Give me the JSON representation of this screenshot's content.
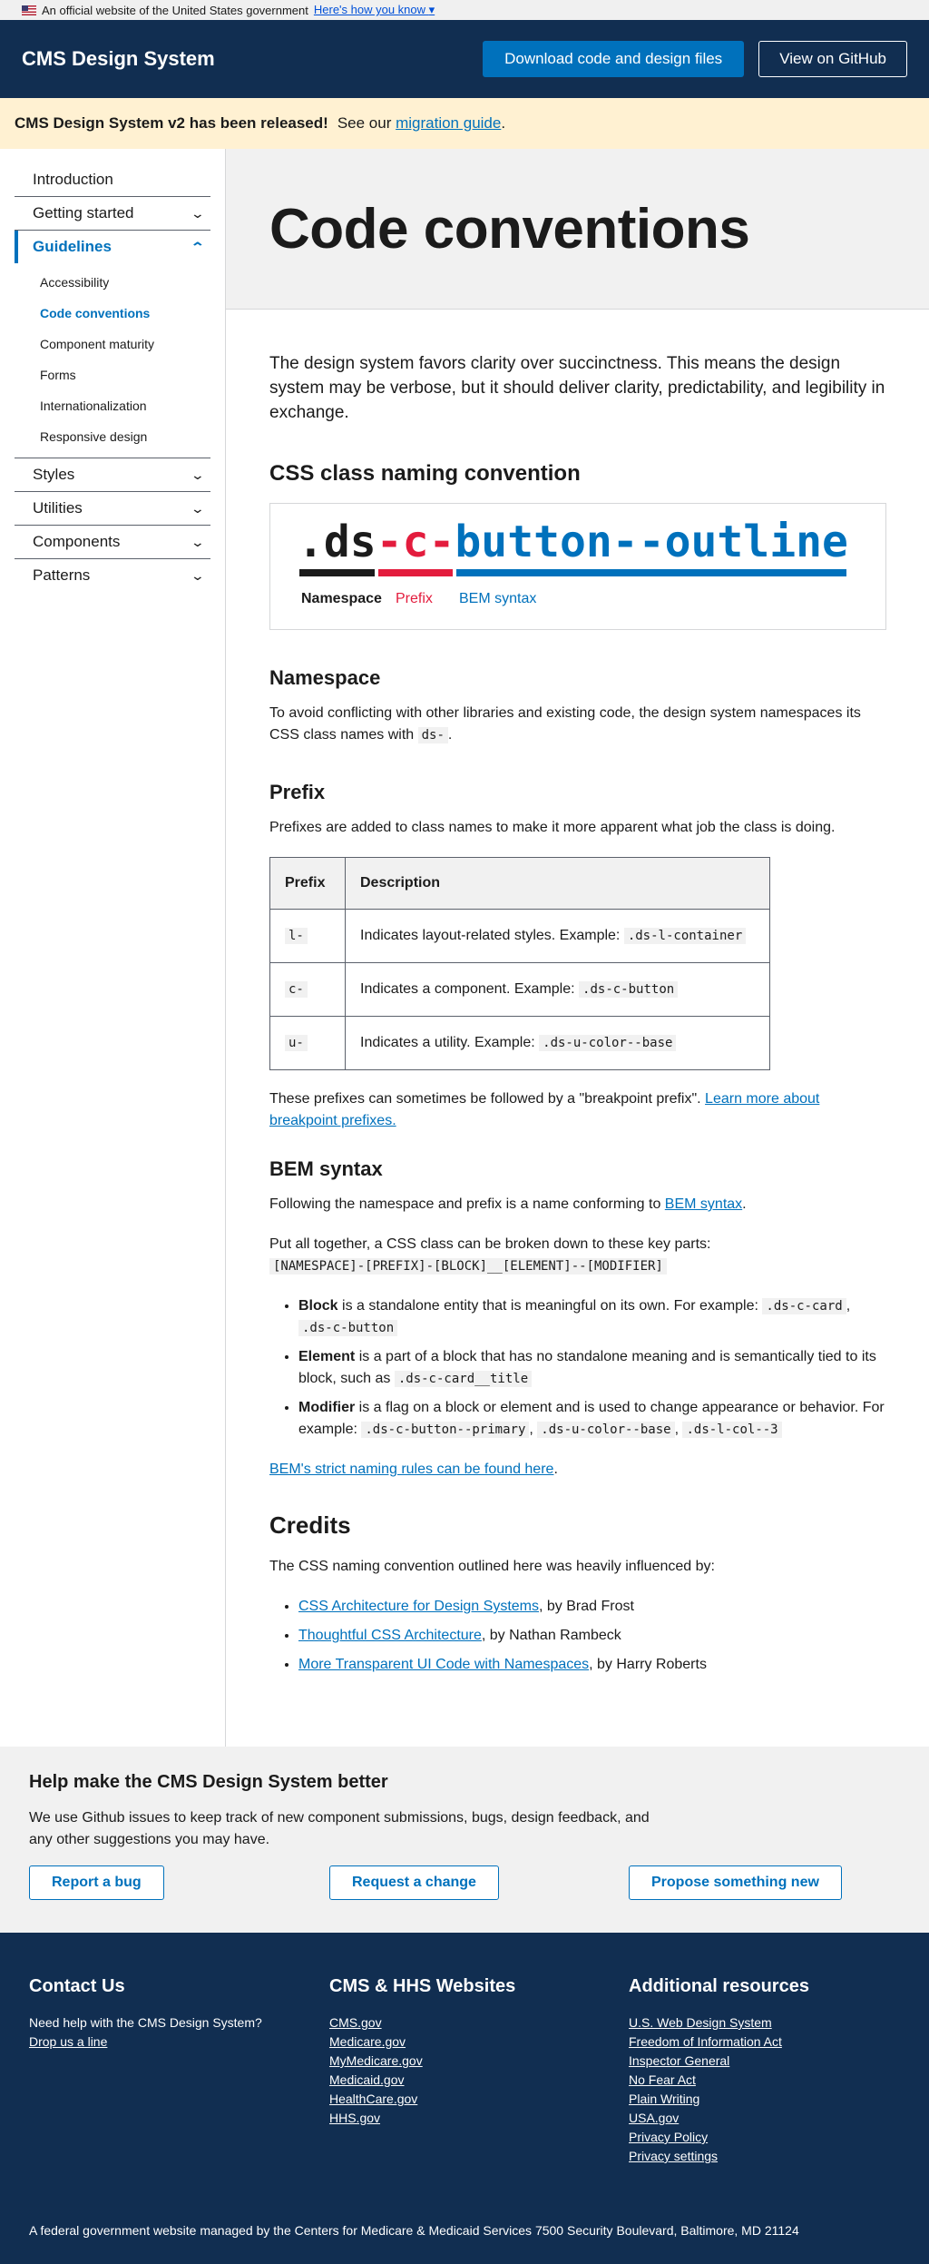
{
  "gov_banner": {
    "text": "An official website of the United States government",
    "link": "Here's how you know"
  },
  "header": {
    "title": "CMS Design System",
    "download_label": "Download code and design files",
    "github_label": "View on GitHub"
  },
  "alert": {
    "bold": "CMS Design System v2 has been released!",
    "pre": "See our",
    "link": "migration guide",
    "post": "."
  },
  "sidebar": {
    "intro": "Introduction",
    "getting_started": "Getting started",
    "guidelines": "Guidelines",
    "sub": [
      "Accessibility",
      "Code conventions",
      "Component maturity",
      "Forms",
      "Internationalization",
      "Responsive design"
    ],
    "styles": "Styles",
    "utilities": "Utilities",
    "components": "Components",
    "patterns": "Patterns"
  },
  "page": {
    "title": "Code conventions",
    "lead": "The design system favors clarity over succinctness. This means the design system may be verbose, but it should deliver clarity, predictability, and legibility in exchange.",
    "h_naming": "CSS class naming convention",
    "diagram": {
      "ns": ".ds",
      "prefix": "-c-",
      "bem": "button--outline",
      "label_ns": "Namespace",
      "label_prefix": "Prefix",
      "label_bem": "BEM syntax"
    },
    "h_namespace": "Namespace",
    "ns_text": "To avoid conflicting with other libraries and existing code, the design system namespaces its CSS class names with",
    "ns_code": "ds-",
    "h_prefix": "Prefix",
    "prefix_text": "Prefixes are added to class names to make it more apparent what job the class is doing.",
    "table": {
      "headers": [
        "Prefix",
        "Description"
      ],
      "rows": [
        {
          "prefix": "l-",
          "desc": "Indicates layout-related styles. Example:",
          "code": ".ds-l-container"
        },
        {
          "prefix": "c-",
          "desc": "Indicates a component. Example:",
          "code": ".ds-c-button"
        },
        {
          "prefix": "u-",
          "desc": "Indicates a utility. Example:",
          "code": ".ds-u-color--base"
        }
      ]
    },
    "breakpoint_text": "These prefixes can sometimes be followed by a \"breakpoint prefix\".",
    "breakpoint_link": "Learn more about breakpoint prefixes.",
    "h_bem": "BEM syntax",
    "bem_text": "Following the namespace and prefix is a name conforming to",
    "bem_link": "BEM syntax",
    "together_text": "Put all together, a CSS class can be broken down to these key parts:",
    "together_code": "[NAMESPACE]-[PREFIX]-[BLOCK]__[ELEMENT]--[MODIFIER]",
    "bullets": {
      "block_b": "Block",
      "block_t": "is a standalone entity that is meaningful on its own. For example:",
      "block_c1": ".ds-c-card",
      "block_c2": ".ds-c-button",
      "element_b": "Element",
      "element_t": "is a part of a block that has no standalone meaning and is semantically tied to its block, such as",
      "element_c": ".ds-c-card__title",
      "modifier_b": "Modifier",
      "modifier_t": "is a flag on a block or element and is used to change appearance or behavior. For example:",
      "modifier_c1": ".ds-c-button--primary",
      "modifier_c2": ".ds-u-color--base",
      "modifier_c3": ".ds-l-col--3"
    },
    "bem_rules_link": "BEM's strict naming rules can be found here",
    "h_credits": "Credits",
    "credits_text": "The CSS naming convention outlined here was heavily influenced by:",
    "credits": [
      {
        "link": "CSS Architecture for Design Systems",
        "by": ", by Brad Frost"
      },
      {
        "link": "Thoughtful CSS Architecture",
        "by": ", by Nathan Rambeck"
      },
      {
        "link": "More Transparent UI Code with Namespaces",
        "by": ", by Harry Roberts"
      }
    ]
  },
  "feedback": {
    "title": "Help make the CMS Design System better",
    "text": "We use Github issues to keep track of new component submissions, bugs, design feedback, and any other suggestions you may have.",
    "bug": "Report a bug",
    "change": "Request a change",
    "propose": "Propose something new"
  },
  "footer": {
    "contact_title": "Contact Us",
    "contact_text": "Need help with the CMS Design System?",
    "contact_link": "Drop us a line",
    "cms_title": "CMS & HHS Websites",
    "cms_links": [
      "CMS.gov",
      "Medicare.gov",
      "MyMedicare.gov",
      "Medicaid.gov",
      "HealthCare.gov",
      "HHS.gov"
    ],
    "res_title": "Additional resources",
    "res_links": [
      "U.S. Web Design System",
      "Freedom of Information Act",
      "Inspector General",
      "No Fear Act",
      "Plain Writing",
      "USA.gov",
      "Privacy Policy",
      "Privacy settings"
    ],
    "bottom": "A federal government website managed by the Centers for Medicare & Medicaid Services 7500 Security Boulevard, Baltimore, MD 21124"
  },
  "colors": {
    "navy": "#112e51",
    "primary": "#0071bc",
    "red": "#e31c3d",
    "alert": "#fff1d2"
  }
}
